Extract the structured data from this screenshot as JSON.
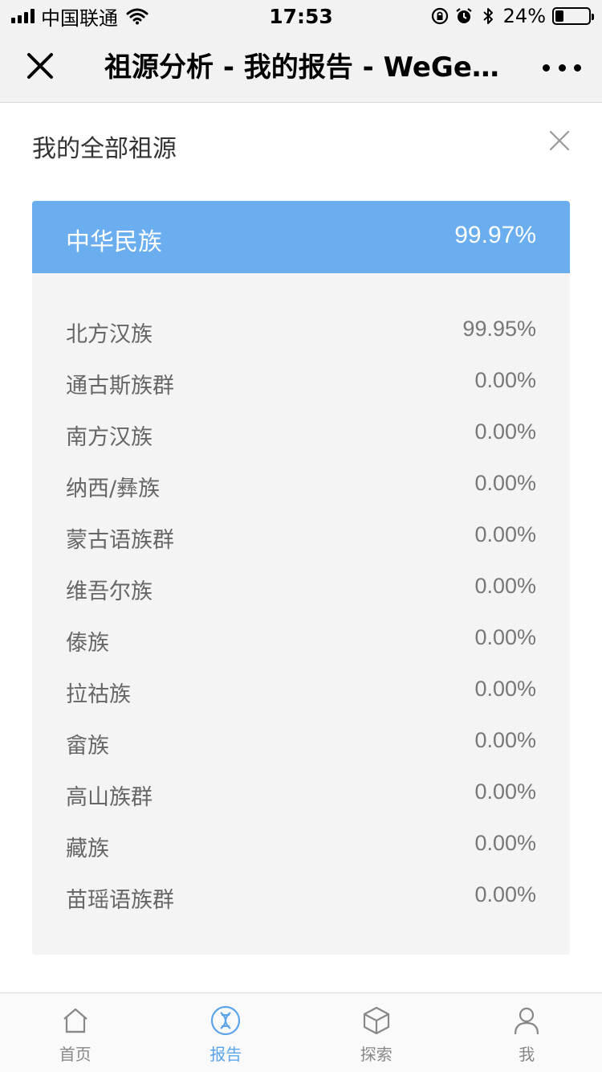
{
  "status_bar": {
    "carrier": "中国联通",
    "time": "17:53",
    "battery_percent": "24%",
    "battery_level": 0.24,
    "icons": [
      "signal-icon",
      "wifi-icon",
      "rotation-lock-icon",
      "alarm-icon",
      "bluetooth-icon",
      "battery-icon"
    ]
  },
  "nav": {
    "title": "祖源分析 - 我的报告 - WeGene",
    "close_icon": "close-icon",
    "more_icon": "more-icon"
  },
  "panel": {
    "title": "我的全部祖源",
    "close_icon": "close-icon"
  },
  "group": {
    "name": "中华民族",
    "percent": "99.97%",
    "color": "#6aaef0",
    "items": [
      {
        "name": "北方汉族",
        "percent": "99.95%"
      },
      {
        "name": "通古斯族群",
        "percent": "0.00%"
      },
      {
        "name": "南方汉族",
        "percent": "0.00%"
      },
      {
        "name": "纳西/彝族",
        "percent": "0.00%"
      },
      {
        "name": "蒙古语族群",
        "percent": "0.00%"
      },
      {
        "name": "维吾尔族",
        "percent": "0.00%"
      },
      {
        "name": "傣族",
        "percent": "0.00%"
      },
      {
        "name": "拉祜族",
        "percent": "0.00%"
      },
      {
        "name": "畲族",
        "percent": "0.00%"
      },
      {
        "name": "高山族群",
        "percent": "0.00%"
      },
      {
        "name": "藏族",
        "percent": "0.00%"
      },
      {
        "name": "苗瑶语族群",
        "percent": "0.00%"
      }
    ]
  },
  "tab_bar": {
    "active_color": "#5ba4ec",
    "tabs": [
      {
        "label": "首页",
        "icon": "home-icon",
        "active": false
      },
      {
        "label": "报告",
        "icon": "dna-icon",
        "active": true
      },
      {
        "label": "探索",
        "icon": "cube-icon",
        "active": false
      },
      {
        "label": "我",
        "icon": "user-icon",
        "active": false
      }
    ]
  }
}
